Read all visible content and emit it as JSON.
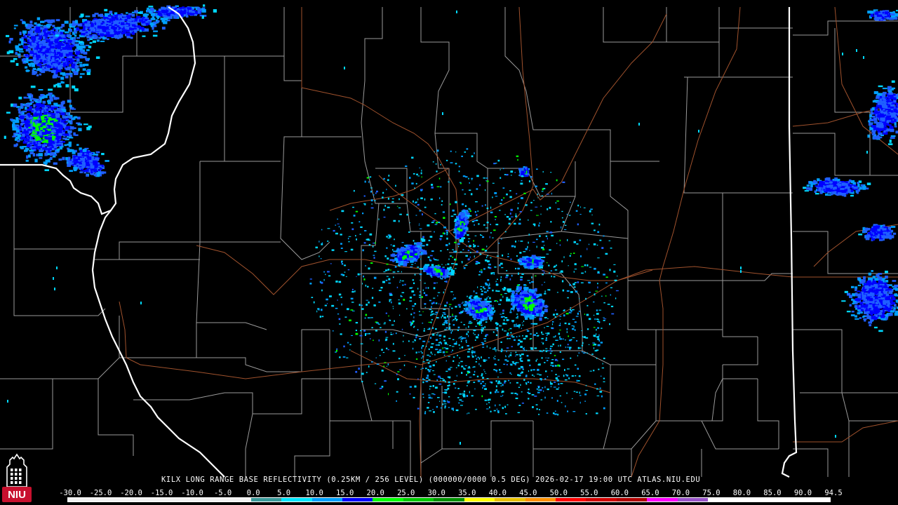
{
  "header": {
    "caption": "KILX LONG RANGE BASE REFLECTIVITY (0.25KM / 256 LEVEL) (000000/0000 0.5 DEG) 2026-02-17 19:00 UTC  ATLAS.NIU.EDU"
  },
  "logo": {
    "text": "NIU",
    "colors": {
      "badge": "#c8102e",
      "text": "#ffffff",
      "tower": "#ffffff"
    }
  },
  "scale": {
    "labels": [
      "-30.0",
      "-25.0",
      "-20.0",
      "-15.0",
      "-10.0",
      "-5.0",
      "0.0",
      "5.0",
      "10.0",
      "15.0",
      "20.0",
      "25.0",
      "30.0",
      "35.0",
      "40.0",
      "45.0",
      "50.0",
      "55.0",
      "60.0",
      "65.0",
      "70.0",
      "75.0",
      "80.0",
      "85.0",
      "90.0",
      "94.5"
    ],
    "colors": [
      "#f2f2f2",
      "#f2f2f2",
      "#f2f2f2",
      "#f2f2f2",
      "#f2f2f2",
      "#f2f2f2",
      "#3a9a9a",
      "#00e5ff",
      "#00a0ff",
      "#0000ff",
      "#00ff00",
      "#00c800",
      "#009000",
      "#ffff00",
      "#e7c000",
      "#ff9000",
      "#ff0000",
      "#d00000",
      "#b00000",
      "#ff00ff",
      "#9955c9",
      "#ffffff",
      "#ffffff",
      "#ffffff",
      "#ffffff"
    ]
  },
  "map": {
    "colors": {
      "background": "#000000",
      "county_lines": "#9a9a9a",
      "state_lines": "#ffffff",
      "highways": "#a0522d"
    },
    "echo_colors": [
      "#00d8ff",
      "#00a0ff",
      "#1f5fff",
      "#0000ff",
      "#00ff00",
      "#ffff00"
    ]
  }
}
